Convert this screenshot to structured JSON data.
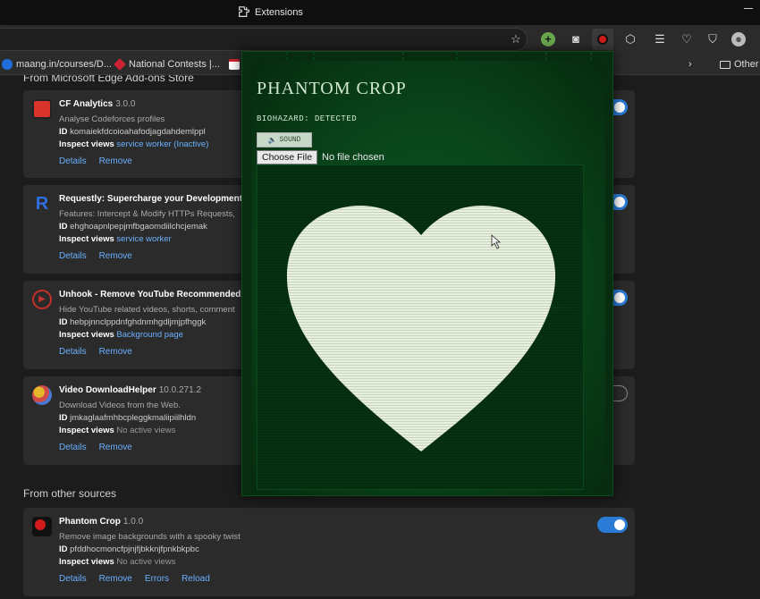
{
  "titlebar": {
    "title": "Extensions"
  },
  "bookmarks": [
    {
      "label": "maang.in/courses/D..."
    },
    {
      "label": "National Contests |..."
    },
    {
      "label": ""
    },
    {
      "label": "Other"
    }
  ],
  "store_section": {
    "heading": "From Microsoft Edge Add-ons Store"
  },
  "other_section": {
    "heading": "From other sources"
  },
  "common": {
    "id_label": "ID",
    "inspect_label": "Inspect views",
    "details": "Details",
    "remove": "Remove",
    "errors": "Errors",
    "reload": "Reload"
  },
  "extensions": [
    {
      "name": "CF Analytics",
      "version": "3.0.0",
      "desc": "Analyse Codeforces profiles",
      "id": "komaiekfdcoioahafodjagdahdemlppl",
      "inspect": "service worker (Inactive)",
      "enabled": true,
      "icon_color": "#d9342b"
    },
    {
      "name": "Requestly: Supercharge your Development &",
      "version": "",
      "desc": "Features: Intercept & Modify HTTPs Requests,",
      "id": "ehghoapnlpepjmfbgaomdiilchcjemak",
      "inspect": "service worker",
      "enabled": true,
      "icon_color": "#2f6ee0"
    },
    {
      "name": "Unhook - Remove YouTube Recommended &",
      "version": "",
      "desc": "Hide YouTube related videos, shorts, comment",
      "id": "hebpjnnclppdnfghdnmhgdljmjpfhggk",
      "inspect": "Background page",
      "enabled": true,
      "icon_color": "#c4302b"
    },
    {
      "name": "Video DownloadHelper",
      "version": "10.0.271.2",
      "desc": "Download Videos from the Web.",
      "id": "jmkaglaafmhbcpleggkmaliipiilhldn",
      "inspect": "No active views",
      "enabled": false,
      "icon_color": "#e5b82b"
    },
    {
      "name": "Phantom Crop",
      "version": "1.0.0",
      "desc": "Remove image backgrounds with a spooky twist",
      "id": "pfddhocmoncfpjnjfjbkknjfpnkbkpbc",
      "inspect": "No active views",
      "enabled": true,
      "icon_color": "#d21b1b"
    }
  ],
  "popup": {
    "title": "PHANTOM CROP",
    "status": "BIOHAZARD: DETECTED",
    "sound_label": "SOUND",
    "choose_file": "Choose File",
    "no_file": "No file chosen",
    "accent": "#0e5a22",
    "heart_color": "#e6f0dc"
  }
}
